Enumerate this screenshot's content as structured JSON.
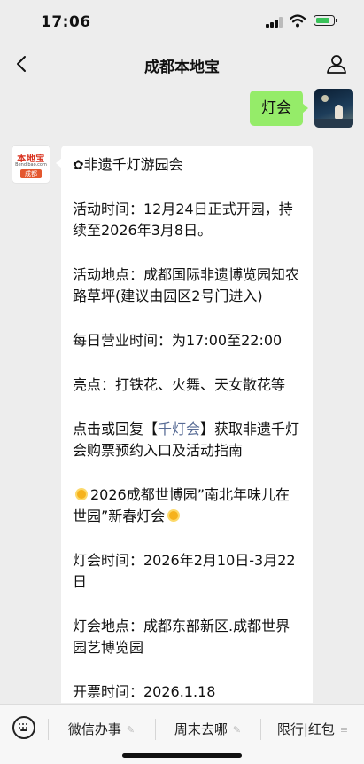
{
  "status_bar": {
    "time": "17:06"
  },
  "nav": {
    "title": "成都本地宝"
  },
  "user_message": {
    "text": "灯会"
  },
  "bot_avatar": {
    "logo_main": "本地宝",
    "logo_sub": "Bendibao.com",
    "logo_city": "成都"
  },
  "bot_message": {
    "title": "非遗千灯游园会",
    "time": "活动时间：12月24日正式开园，持续至2026年3月8日。",
    "location": "活动地点：成都国际非遗博览园知农路草坪(建议由园区2号门进入)",
    "hours": "每日营业时间：为17:00至22:00",
    "highlights": "亮点：打铁花、火舞、天女散花等",
    "reply_prefix": "点击或回复【",
    "reply_keyword": "千灯会",
    "reply_suffix": "】获取非遗千灯会购票预约入口及活动指南",
    "event2_title": "2026成都世博园”南北年味儿在世园”新春灯会",
    "event2_time": "灯会时间：2026年2月10日-3月22日",
    "event2_location": "灯会地点：成都东部新区.成都世界园艺博览园",
    "event2_ticket": "开票时间：2026.1.18"
  },
  "bottom_menu": {
    "items": [
      {
        "label": "微信办事",
        "icon": "pencil-icon"
      },
      {
        "label": "周末去哪",
        "icon": "pencil-icon"
      },
      {
        "label": "限行|红包",
        "icon": "menu-lines-icon"
      }
    ]
  },
  "colors": {
    "background": "#ededed",
    "user_bubble": "#95ec69",
    "bot_bubble": "#ffffff",
    "link": "#576b95",
    "battery_fill": "#3ac25a"
  }
}
